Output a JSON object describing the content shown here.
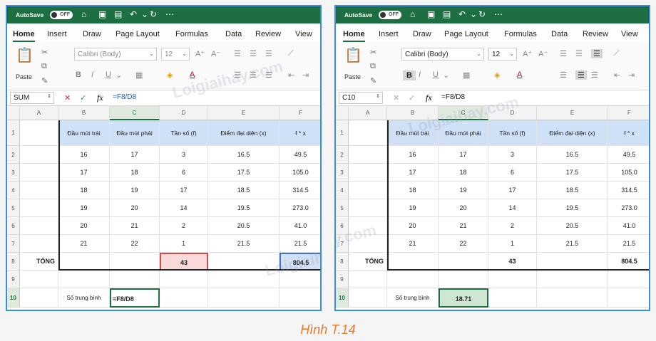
{
  "app": {
    "autosave_label": "AutoSave",
    "autosave_state": "OFF",
    "menu": [
      "Home",
      "Insert",
      "Draw",
      "Page Layout",
      "Formulas",
      "Data",
      "Review",
      "View"
    ],
    "font_name": "Calibri (Body)",
    "font_size": "12",
    "paste_label": "Paste",
    "fx_label": "fx"
  },
  "windows": {
    "left": {
      "namebox": "SUM",
      "formula": "=F8/D8",
      "c10": "=F8/D8"
    },
    "right": {
      "namebox": "C10",
      "formula": "=F8/D8",
      "c10": "18.71"
    }
  },
  "sheet": {
    "columns": [
      "A",
      "B",
      "C",
      "D",
      "E",
      "F"
    ],
    "rows": [
      "1",
      "2",
      "3",
      "4",
      "5",
      "6",
      "7",
      "8",
      "9",
      "10"
    ],
    "headers": {
      "B": "Đầu mút trái",
      "C": "Đầu mút phải",
      "D": "Tần số (f)",
      "E": "Điểm đại diện (x)",
      "F": "f * x"
    },
    "data": [
      [
        "16",
        "17",
        "3",
        "16.5",
        "49.5"
      ],
      [
        "17",
        "18",
        "6",
        "17.5",
        "105.0"
      ],
      [
        "18",
        "19",
        "17",
        "18.5",
        "314.5"
      ],
      [
        "19",
        "20",
        "14",
        "19.5",
        "273.0"
      ],
      [
        "20",
        "21",
        "2",
        "20.5",
        "41.0"
      ],
      [
        "21",
        "22",
        "1",
        "21.5",
        "21.5"
      ]
    ],
    "total_label": "TỔNG",
    "total_d": "43",
    "total_f": "804.5",
    "mean_label": "Số trung bình"
  },
  "watermark": "Loigiaihay.com",
  "caption": "Hình T.14",
  "colors": {
    "excel_green": "#1d6f42",
    "header_fill": "#cfe1f6",
    "caption": "#e87a2a"
  }
}
